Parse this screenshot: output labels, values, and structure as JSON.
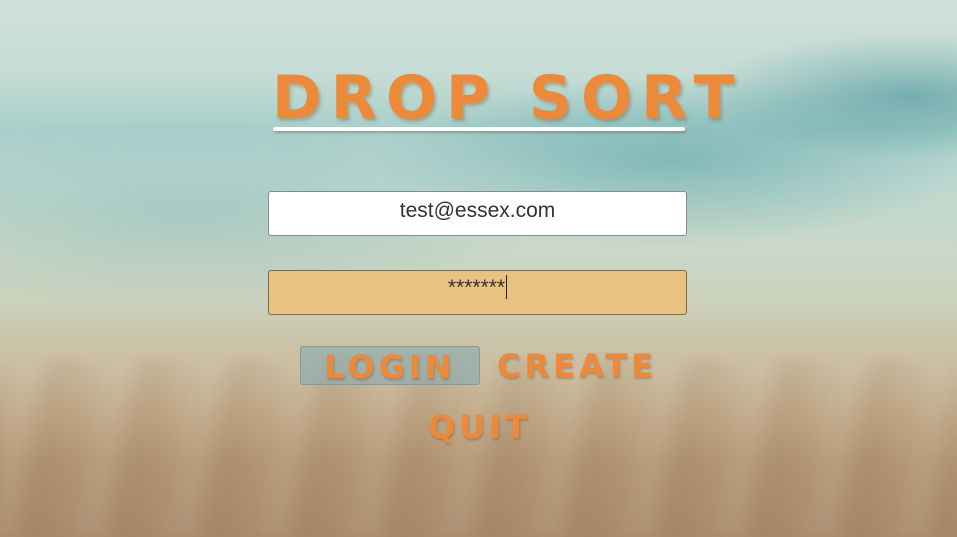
{
  "game": {
    "title": "DROP SORT"
  },
  "login_form": {
    "email_value": "test@essex.com",
    "password_value": "*******",
    "login_label": "LOGIN",
    "create_label": "CREATE",
    "quit_label": "QUIT"
  },
  "colors": {
    "accent_orange": "#ec8a3a",
    "password_field_bg": "#e8c280",
    "login_button_bg": "#8caaaf"
  }
}
